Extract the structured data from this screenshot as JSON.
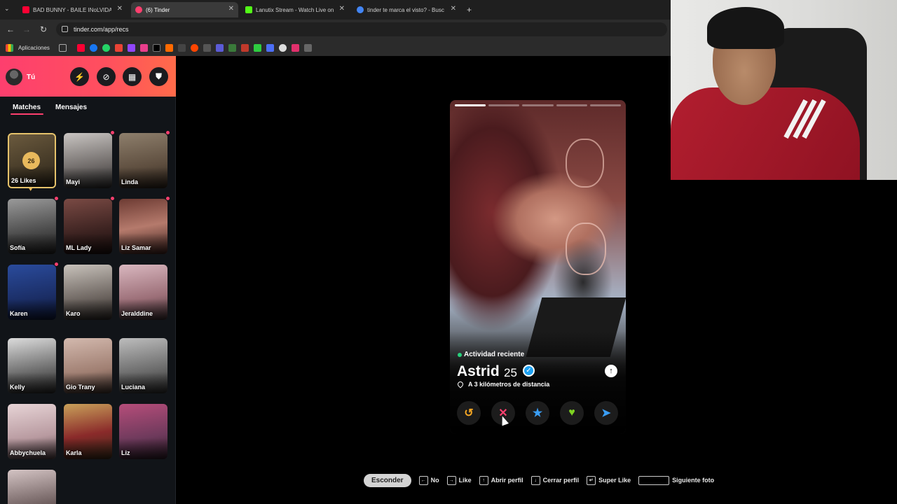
{
  "browser": {
    "tabs": [
      {
        "title": "BAD BUNNY - BAILE INoLVIDAB",
        "color": "#ff0033"
      },
      {
        "title": "(6) Tinder",
        "color": "#fd3f6e"
      },
      {
        "title": "Lanutix Stream - Watch Live on",
        "color": "#53fc18"
      },
      {
        "title": "tinder te marca el visto? - Busc",
        "color": "#4285f4"
      }
    ],
    "new_tab": "+",
    "url": "tinder.com/app/recs",
    "bookmarks_label": "Aplicaciones"
  },
  "sidebar": {
    "user_label": "Tú",
    "header_buttons": [
      "boost-icon",
      "explore-icon",
      "briefcase-icon",
      "shield-icon"
    ],
    "tabs": {
      "matches": "Matches",
      "messages": "Mensajes"
    },
    "likes": {
      "count": "26",
      "label": "26 Likes"
    },
    "matches": [
      {
        "name": "Mayi",
        "dot": true
      },
      {
        "name": "Linda",
        "dot": true
      },
      {
        "name": "Sofía",
        "dot": true
      },
      {
        "name": "ML Lady",
        "dot": true
      },
      {
        "name": "Liz Samar",
        "dot": true
      },
      {
        "name": "Karen",
        "dot": true
      },
      {
        "name": "Karo",
        "dot": false
      },
      {
        "name": "Jeralddine",
        "dot": false
      },
      {
        "name": "Kelly",
        "dot": false
      },
      {
        "name": "Gio Trany",
        "dot": false
      },
      {
        "name": "Luciana",
        "dot": false
      },
      {
        "name": "Abbychuela",
        "dot": false
      },
      {
        "name": "Karla",
        "dot": false
      },
      {
        "name": "Liz",
        "dot": false
      }
    ]
  },
  "profile": {
    "activity": "Actividad reciente",
    "name": "Astrid",
    "age": "25",
    "distance": "A 3 kilómetros de distancia",
    "photo_count": 5,
    "photo_active": 0,
    "actions": [
      {
        "name": "rewind-icon",
        "glyph": "↺",
        "color": "#f5a623"
      },
      {
        "name": "nope-icon",
        "glyph": "✕",
        "color": "#fd3f6e"
      },
      {
        "name": "superlike-icon",
        "glyph": "★",
        "color": "#3a9ef5"
      },
      {
        "name": "like-icon",
        "glyph": "♥",
        "color": "#7ed321"
      },
      {
        "name": "boost-icon",
        "glyph": "➤",
        "color": "#3a9ef5"
      }
    ]
  },
  "hints": {
    "hide": "Esconder",
    "items": [
      "No",
      "Like",
      "Abrir perfil",
      "Cerrar perfil",
      "Super Like",
      "Siguiente foto"
    ]
  }
}
